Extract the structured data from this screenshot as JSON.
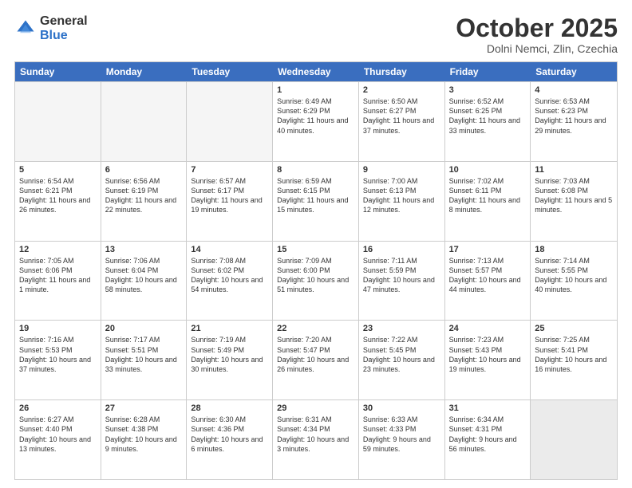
{
  "header": {
    "logo_general": "General",
    "logo_blue": "Blue",
    "title": "October 2025",
    "subtitle": "Dolni Nemci, Zlin, Czechia"
  },
  "weekdays": [
    "Sunday",
    "Monday",
    "Tuesday",
    "Wednesday",
    "Thursday",
    "Friday",
    "Saturday"
  ],
  "weeks": [
    [
      {
        "day": "",
        "empty": true
      },
      {
        "day": "",
        "empty": true
      },
      {
        "day": "",
        "empty": true
      },
      {
        "day": "1",
        "sunrise": "6:49 AM",
        "sunset": "6:29 PM",
        "daylight": "11 hours and 40 minutes."
      },
      {
        "day": "2",
        "sunrise": "6:50 AM",
        "sunset": "6:27 PM",
        "daylight": "11 hours and 37 minutes."
      },
      {
        "day": "3",
        "sunrise": "6:52 AM",
        "sunset": "6:25 PM",
        "daylight": "11 hours and 33 minutes."
      },
      {
        "day": "4",
        "sunrise": "6:53 AM",
        "sunset": "6:23 PM",
        "daylight": "11 hours and 29 minutes."
      }
    ],
    [
      {
        "day": "5",
        "sunrise": "6:54 AM",
        "sunset": "6:21 PM",
        "daylight": "11 hours and 26 minutes."
      },
      {
        "day": "6",
        "sunrise": "6:56 AM",
        "sunset": "6:19 PM",
        "daylight": "11 hours and 22 minutes."
      },
      {
        "day": "7",
        "sunrise": "6:57 AM",
        "sunset": "6:17 PM",
        "daylight": "11 hours and 19 minutes."
      },
      {
        "day": "8",
        "sunrise": "6:59 AM",
        "sunset": "6:15 PM",
        "daylight": "11 hours and 15 minutes."
      },
      {
        "day": "9",
        "sunrise": "7:00 AM",
        "sunset": "6:13 PM",
        "daylight": "11 hours and 12 minutes."
      },
      {
        "day": "10",
        "sunrise": "7:02 AM",
        "sunset": "6:11 PM",
        "daylight": "11 hours and 8 minutes."
      },
      {
        "day": "11",
        "sunrise": "7:03 AM",
        "sunset": "6:08 PM",
        "daylight": "11 hours and 5 minutes."
      }
    ],
    [
      {
        "day": "12",
        "sunrise": "7:05 AM",
        "sunset": "6:06 PM",
        "daylight": "11 hours and 1 minute."
      },
      {
        "day": "13",
        "sunrise": "7:06 AM",
        "sunset": "6:04 PM",
        "daylight": "10 hours and 58 minutes."
      },
      {
        "day": "14",
        "sunrise": "7:08 AM",
        "sunset": "6:02 PM",
        "daylight": "10 hours and 54 minutes."
      },
      {
        "day": "15",
        "sunrise": "7:09 AM",
        "sunset": "6:00 PM",
        "daylight": "10 hours and 51 minutes."
      },
      {
        "day": "16",
        "sunrise": "7:11 AM",
        "sunset": "5:59 PM",
        "daylight": "10 hours and 47 minutes."
      },
      {
        "day": "17",
        "sunrise": "7:13 AM",
        "sunset": "5:57 PM",
        "daylight": "10 hours and 44 minutes."
      },
      {
        "day": "18",
        "sunrise": "7:14 AM",
        "sunset": "5:55 PM",
        "daylight": "10 hours and 40 minutes."
      }
    ],
    [
      {
        "day": "19",
        "sunrise": "7:16 AM",
        "sunset": "5:53 PM",
        "daylight": "10 hours and 37 minutes."
      },
      {
        "day": "20",
        "sunrise": "7:17 AM",
        "sunset": "5:51 PM",
        "daylight": "10 hours and 33 minutes."
      },
      {
        "day": "21",
        "sunrise": "7:19 AM",
        "sunset": "5:49 PM",
        "daylight": "10 hours and 30 minutes."
      },
      {
        "day": "22",
        "sunrise": "7:20 AM",
        "sunset": "5:47 PM",
        "daylight": "10 hours and 26 minutes."
      },
      {
        "day": "23",
        "sunrise": "7:22 AM",
        "sunset": "5:45 PM",
        "daylight": "10 hours and 23 minutes."
      },
      {
        "day": "24",
        "sunrise": "7:23 AM",
        "sunset": "5:43 PM",
        "daylight": "10 hours and 19 minutes."
      },
      {
        "day": "25",
        "sunrise": "7:25 AM",
        "sunset": "5:41 PM",
        "daylight": "10 hours and 16 minutes."
      }
    ],
    [
      {
        "day": "26",
        "sunrise": "6:27 AM",
        "sunset": "4:40 PM",
        "daylight": "10 hours and 13 minutes."
      },
      {
        "day": "27",
        "sunrise": "6:28 AM",
        "sunset": "4:38 PM",
        "daylight": "10 hours and 9 minutes."
      },
      {
        "day": "28",
        "sunrise": "6:30 AM",
        "sunset": "4:36 PM",
        "daylight": "10 hours and 6 minutes."
      },
      {
        "day": "29",
        "sunrise": "6:31 AM",
        "sunset": "4:34 PM",
        "daylight": "10 hours and 3 minutes."
      },
      {
        "day": "30",
        "sunrise": "6:33 AM",
        "sunset": "4:33 PM",
        "daylight": "9 hours and 59 minutes."
      },
      {
        "day": "31",
        "sunrise": "6:34 AM",
        "sunset": "4:31 PM",
        "daylight": "9 hours and 56 minutes."
      },
      {
        "day": "",
        "empty": true,
        "shaded": true
      }
    ]
  ]
}
